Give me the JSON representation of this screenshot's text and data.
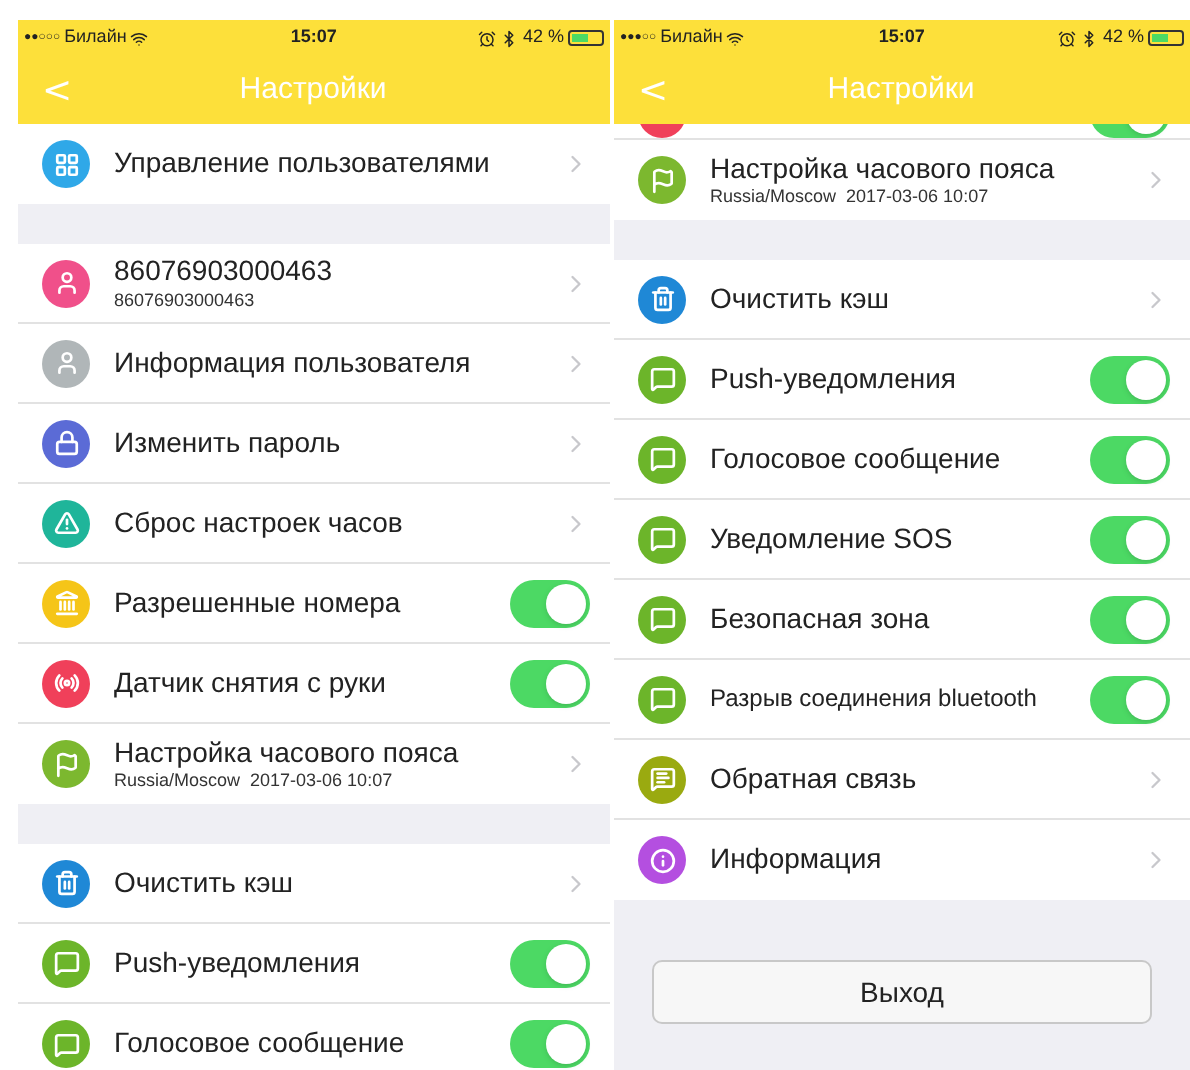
{
  "screens": [
    {
      "status_bar": {
        "signal": "●●○○○",
        "carrier": "Билайн",
        "time": "15:07",
        "battery": "42 %"
      },
      "nav": {
        "back": "<",
        "title": "Настройки"
      },
      "sections": [
        {
          "rows": [
            {
              "kind": "link",
              "label": "Управление пользователями"
            }
          ]
        },
        {
          "rows": [
            {
              "kind": "link",
              "label": "86076903000463",
              "subtitle": "86076903000463"
            },
            {
              "kind": "link",
              "label": "Информация пользователя"
            },
            {
              "kind": "link",
              "label": "Изменить пароль"
            },
            {
              "kind": "link",
              "label": "Сброс настроек часов"
            },
            {
              "kind": "toggle",
              "label": "Разрешенные номера",
              "on": true
            },
            {
              "kind": "toggle",
              "label": "Датчик снятия с руки",
              "on": true
            },
            {
              "kind": "link",
              "label": "Настройка часового пояса",
              "subtitle": "Russia/Moscow  2017-03-06 10:07"
            }
          ]
        },
        {
          "rows": [
            {
              "kind": "link",
              "label": "Очистить кэш"
            },
            {
              "kind": "toggle",
              "label": "Push-уведомления",
              "on": true
            },
            {
              "kind": "toggle",
              "label": "Голосовое сообщение",
              "on": true
            }
          ]
        }
      ]
    },
    {
      "status_bar": {
        "signal": "●●●○○",
        "carrier": "Билайн",
        "time": "15:07",
        "battery": "42 %"
      },
      "nav": {
        "back": "<",
        "title": "Настройки"
      },
      "sections": [
        {
          "rows": [
            {
              "kind": "toggle",
              "on": true
            },
            {
              "kind": "link",
              "label": "Настройка часового пояса",
              "subtitle": "Russia/Moscow  2017-03-06 10:07"
            }
          ]
        },
        {
          "rows": [
            {
              "kind": "link",
              "label": "Очистить кэш"
            },
            {
              "kind": "toggle",
              "label": "Push-уведомления",
              "on": true
            },
            {
              "kind": "toggle",
              "label": "Голосовое сообщение",
              "on": true
            },
            {
              "kind": "toggle",
              "label": "Уведомление SOS",
              "on": true
            },
            {
              "kind": "toggle",
              "label": "Безопасная зона",
              "on": true
            },
            {
              "kind": "toggle",
              "label": "Разрыв соединения bluetooth",
              "on": true
            },
            {
              "kind": "link",
              "label": "Обратная связь"
            },
            {
              "kind": "link",
              "label": "Информация"
            }
          ]
        }
      ],
      "logout": "Выход"
    }
  ]
}
